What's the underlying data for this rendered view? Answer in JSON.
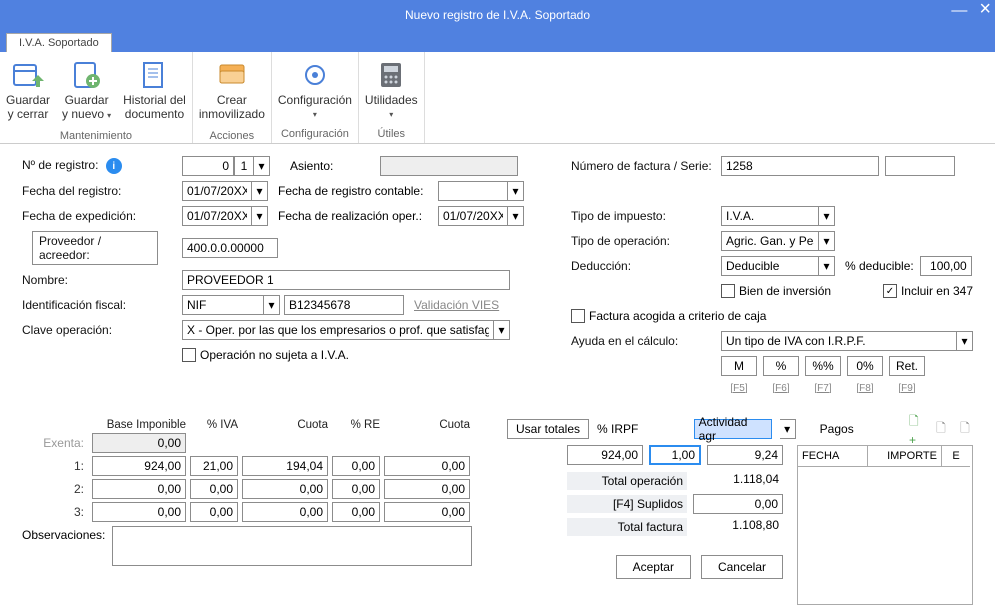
{
  "title": "Nuevo registro de I.V.A. Soportado",
  "tab_name": "I.V.A. Soportado",
  "ribbon": {
    "mant": {
      "save_close": [
        "Guardar",
        "y cerrar"
      ],
      "save_new": [
        "Guardar",
        "y nuevo"
      ],
      "history": [
        "Historial del",
        "documento"
      ],
      "group_label": "Mantenimiento"
    },
    "acc": {
      "asset": [
        "Crear",
        "inmovilizado"
      ],
      "group_label": "Acciones"
    },
    "conf": {
      "config": "Configuración",
      "group_label": "Configuración"
    },
    "util": {
      "util": "Utilidades",
      "group_label": "Útiles"
    }
  },
  "left": {
    "lbl_reg_no": "Nº de registro:",
    "reg_no": "0",
    "reg_series": "1",
    "lbl_asiento": "Asiento:",
    "asiento": "",
    "lbl_reg_date": "Fecha del registro:",
    "reg_date": "01/07/20XX",
    "lbl_acct_date": "Fecha de registro contable:",
    "acct_date": "",
    "lbl_exp_date": "Fecha de expedición:",
    "exp_date": "01/07/20XX",
    "lbl_oper_date": "Fecha de realización oper.:",
    "oper_date": "01/07/20XX",
    "lbl_provider": "Proveedor / acreedor:",
    "provider_code": "400.0.0.00000",
    "lbl_name": "Nombre:",
    "name": "PROVEEDOR 1",
    "lbl_fiscal": "Identificación fiscal:",
    "fiscal_type": "NIF",
    "fiscal_num": "B12345678",
    "vies": "Validación VIES",
    "lbl_oper_key": "Clave operación:",
    "oper_key": "X - Oper. por las que los empresarios o prof. que satisfagan c",
    "chk_no_iva": "Operación no sujeta a I.V.A."
  },
  "right": {
    "lbl_invoice": "Número de factura / Serie:",
    "invoice_no": "1258",
    "invoice_series": "",
    "lbl_tax_type": "Tipo de impuesto:",
    "tax_type": "I.V.A.",
    "lbl_oper_type": "Tipo de operación:",
    "oper_type": "Agric. Gan. y Pesca",
    "lbl_deduction": "Deducción:",
    "deduction": "Deducible",
    "lbl_pct_ded": "% deducible:",
    "pct_ded": "100,00",
    "chk_invest": "Bien de inversión",
    "chk_347": "Incluir en 347",
    "chk_cash": "Factura acogida a criterio de caja",
    "lbl_calc_help": "Ayuda en el cálculo:",
    "calc_help": "Un tipo de IVA con I.R.P.F.",
    "btns": [
      "M",
      "%",
      "%%",
      "0%",
      "Ret."
    ],
    "hints": [
      "[F5]",
      "[F6]",
      "[F7]",
      "[F8]",
      "[F9]"
    ]
  },
  "grid": {
    "headers": [
      "Base Imponible",
      "% IVA",
      "Cuota",
      "% RE",
      "Cuota"
    ],
    "use_totals": "Usar totales",
    "irpf_lbl": "% IRPF",
    "irpf_sel": "Actividad agr",
    "rows_labels": [
      "Exenta:",
      "1:",
      "2:",
      "3:"
    ],
    "rows": [
      [
        "0,00",
        "",
        "",
        "",
        ""
      ],
      [
        "924,00",
        "21,00",
        "194,04",
        "0,00",
        "0,00"
      ],
      [
        "0,00",
        "0,00",
        "0,00",
        "0,00",
        "0,00"
      ],
      [
        "0,00",
        "0,00",
        "0,00",
        "0,00",
        "0,00"
      ]
    ],
    "irpf_row": [
      "924,00",
      "1,00",
      "9,24"
    ],
    "totals": {
      "oper_lbl": "Total operación",
      "oper": "1.118,04",
      "supl_lbl": "[F4] Suplidos",
      "supl": "0,00",
      "fact_lbl": "Total factura",
      "fact": "1.108,80"
    },
    "obs_lbl": "Observaciones:",
    "obs": ""
  },
  "pagos": {
    "lbl": "Pagos",
    "cols": [
      "FECHA",
      "IMPORTE",
      "E"
    ]
  },
  "dialog": {
    "accept": "Aceptar",
    "cancel": "Cancelar"
  }
}
